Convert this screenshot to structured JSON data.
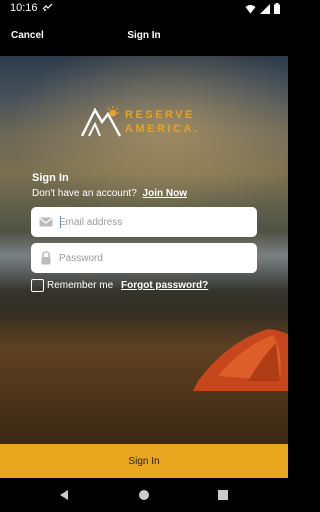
{
  "status_bar": {
    "time": "10:16"
  },
  "app_bar": {
    "cancel_label": "Cancel",
    "title": "Sign In"
  },
  "logo": {
    "line1": "RESERVE",
    "line2": "AMERICA."
  },
  "form": {
    "heading": "Sign In",
    "no_account_text": "Don't have an account?",
    "join_now_label": "Join Now",
    "email_placeholder": "Email address",
    "email_value": "",
    "password_placeholder": "Password",
    "password_value": "",
    "remember_me_label": "Remember me",
    "remember_me_checked": false,
    "forgot_password_label": "Forgot password?"
  },
  "footer": {
    "sign_in_button_label": "Sign In"
  },
  "colors": {
    "accent": "#e8a71f",
    "bar_background": "#000000"
  }
}
